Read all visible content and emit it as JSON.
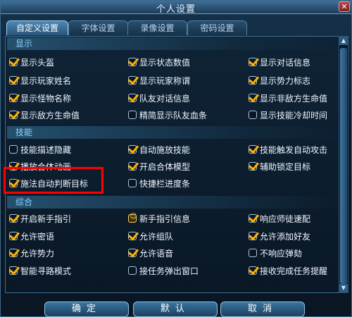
{
  "window": {
    "title": "个人设置",
    "close_icon": "close-icon"
  },
  "tabs": [
    {
      "label": "自定义设置",
      "active": true
    },
    {
      "label": "字体设置",
      "active": false
    },
    {
      "label": "录像设置",
      "active": false
    },
    {
      "label": "密码设置",
      "active": false
    }
  ],
  "sections": [
    {
      "label": "显示"
    },
    {
      "label": "技能"
    },
    {
      "label": "综合"
    }
  ],
  "options": [
    {
      "label": "显示头盔",
      "checked": true
    },
    {
      "label": "显示状态数值",
      "checked": true
    },
    {
      "label": "显示对话信息",
      "checked": true
    },
    {
      "label": "显示玩家姓名",
      "checked": true
    },
    {
      "label": "显示玩家称谓",
      "checked": true
    },
    {
      "label": "显示势力标志",
      "checked": true
    },
    {
      "label": "显示怪物名称",
      "checked": true
    },
    {
      "label": "队友对话信息",
      "checked": true
    },
    {
      "label": "显示非敌方生命值",
      "checked": true
    },
    {
      "label": "显示敌方生命值",
      "checked": true
    },
    {
      "label": "精简显示队友血条",
      "checked": false
    },
    {
      "label": "显示技能冷却时间",
      "checked": false
    },
    {
      "label": "技能描述隐藏",
      "checked": false
    },
    {
      "label": "自动施放技能",
      "checked": true
    },
    {
      "label": "技能触发自动攻击",
      "checked": true
    },
    {
      "label": "播放合体动画",
      "checked": true
    },
    {
      "label": "开启合体模型",
      "checked": true
    },
    {
      "label": "辅助锁定目标",
      "checked": true
    },
    {
      "label": "施法自动判断目标",
      "checked": true
    },
    {
      "label": "快捷栏进度条",
      "checked": false
    },
    {
      "label": "开启新手指引",
      "checked": true
    },
    {
      "label": "新手指引信息",
      "checked": true
    },
    {
      "label": "响应师徒速配",
      "checked": true
    },
    {
      "label": "允许密语",
      "checked": true
    },
    {
      "label": "允许组队",
      "checked": true
    },
    {
      "label": "允许添加好友",
      "checked": true
    },
    {
      "label": "允许势力",
      "checked": true
    },
    {
      "label": "允许语音",
      "checked": true
    },
    {
      "label": "不响应弹劾",
      "checked": false
    },
    {
      "label": "智能寻路模式",
      "checked": true
    },
    {
      "label": "接任务弹出窗口",
      "checked": false
    },
    {
      "label": "接收完成任务提醒",
      "checked": true
    }
  ],
  "buttons": {
    "ok": "确定",
    "default": "默认",
    "cancel": "取消"
  },
  "colors": {
    "accent": "#ffb300",
    "highlight": "#ff0000",
    "section_text": "#8fd1ff"
  }
}
